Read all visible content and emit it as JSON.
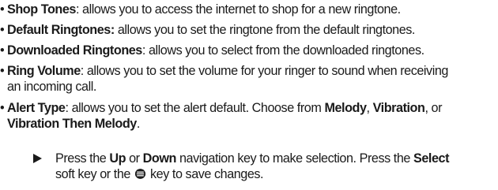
{
  "items": [
    {
      "bullet": "•",
      "term": "Shop Tones",
      "text": ": allows you to access the internet to shop for a new ringtone."
    },
    {
      "bullet": "•",
      "term": "Default Ringtones:",
      "text": " allows you to set the ringtone from the default ringtones."
    },
    {
      "bullet": "•",
      "term": "Downloaded Ringtones",
      "text": ": allows you to select from the downloaded ringtones."
    },
    {
      "bullet": "•",
      "term": "Ring Volume",
      "text": ": allows you to set the volume for your ringer to sound when receiving",
      "cont": "an incoming call."
    },
    {
      "bullet": "•",
      "term": "Alert Type",
      "text": ": allows you to set the alert default. Choose from ",
      "opt1": "Melody",
      "sep1": ", ",
      "opt2": "Vibration",
      "sep2": ", or",
      "opt3": "Vibration Then Melody",
      "end": "."
    }
  ],
  "step": {
    "t1": "Press the ",
    "up": "Up",
    "t2": " or ",
    "down": "Down",
    "t3": " navigation key to make selection. Press the ",
    "select": "Select",
    "t4": "soft key or the ",
    "icon": "ok-key-icon",
    "t5": " key to save changes."
  }
}
